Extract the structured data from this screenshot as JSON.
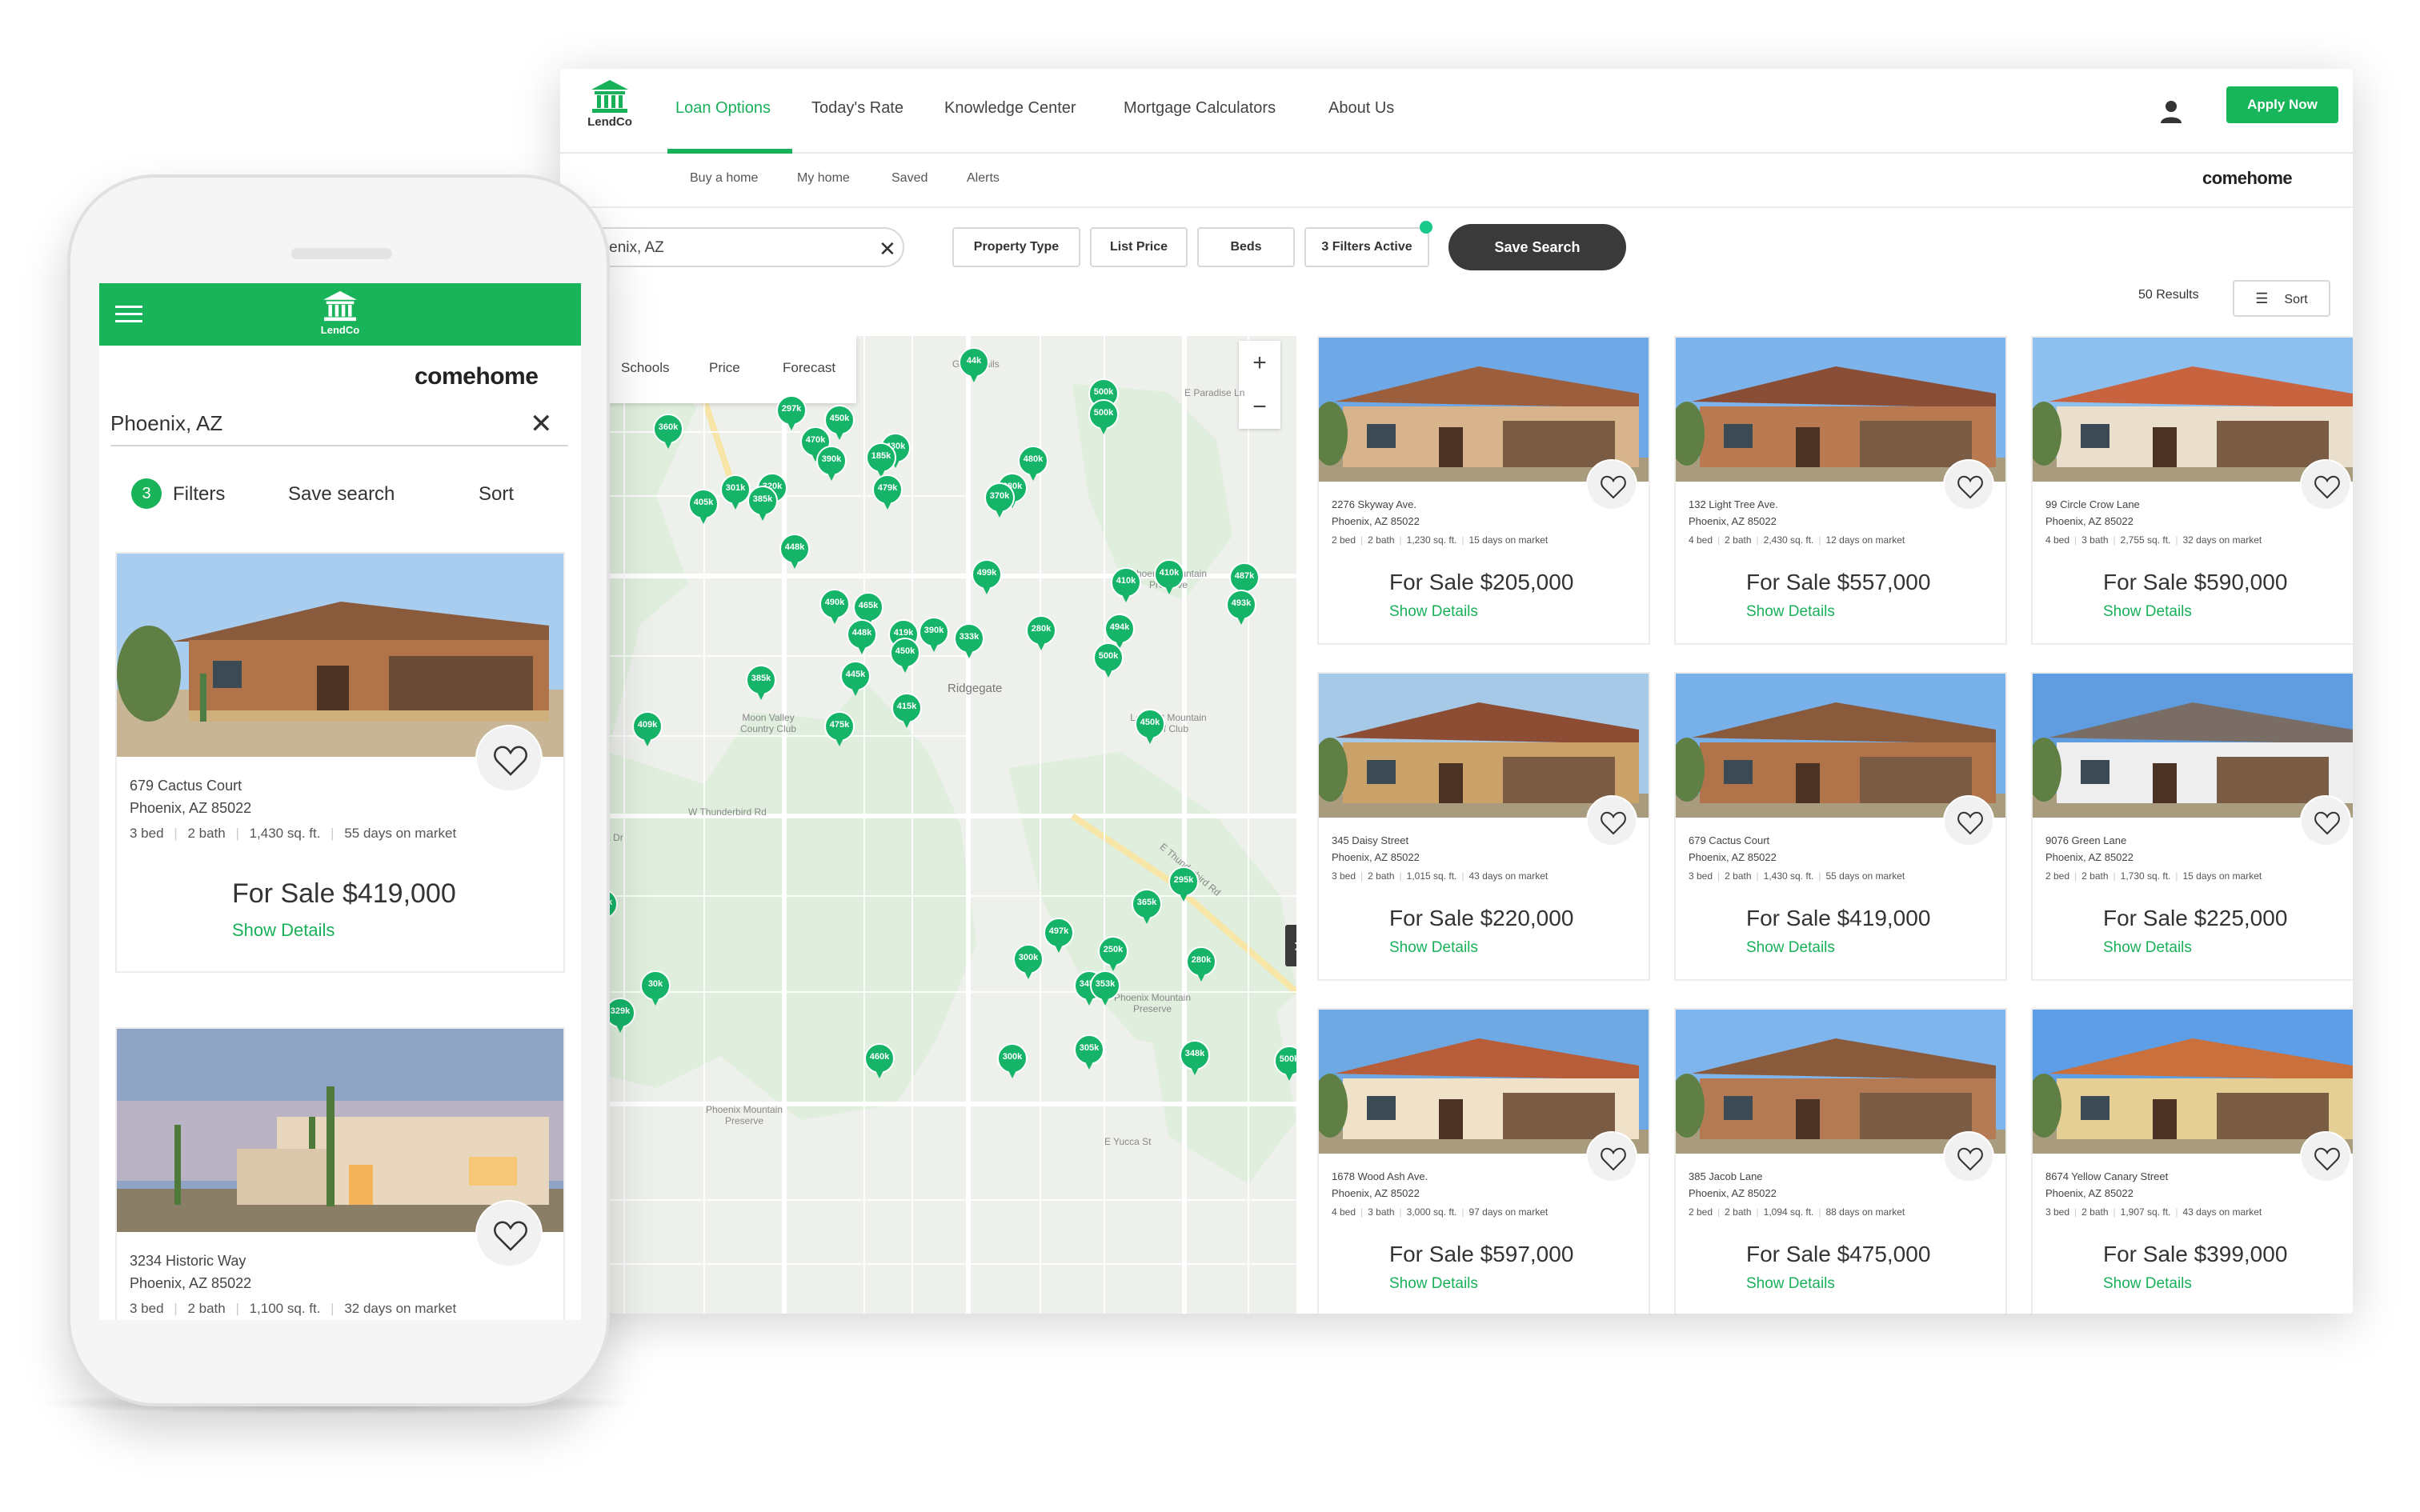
{
  "desktop": {
    "logo": {
      "name": "LendCo"
    },
    "nav": {
      "items": [
        "Loan Options",
        "Today's Rate",
        "Knowledge Center",
        "Mortgage Calculators",
        "About Us"
      ],
      "apply_label": "Apply Now"
    },
    "subnav": {
      "items": [
        "Buy a home",
        "My home",
        "Saved",
        "Alerts"
      ],
      "brand": "comehome"
    },
    "filters": {
      "search_value": "hoenix, AZ",
      "buttons": [
        "Property Type",
        "List Price",
        "Beds",
        "3 Filters Active"
      ],
      "save_search": "Save Search",
      "results": "50 Results",
      "sort": "Sort"
    },
    "map": {
      "tabs": [
        "me",
        "Schools",
        "Price",
        "Forecast"
      ],
      "labels": [
        "Ridgegate",
        "Phoenix Mountain Preserve",
        "Phoenix Mountain Preserve",
        "Phoenix Mountain Preserve",
        "Moon Valley Country Club",
        "Lookout Mountain Golf Club",
        "W Thunderbird Rd",
        "E Thunderbird Rd",
        "Greentrails",
        "E Paradise Ln",
        "W Andora Dr",
        "E Yucca St"
      ],
      "pins": [
        "44k",
        "297k",
        "450k",
        "500k",
        "500k",
        "360k",
        "470k",
        "430k",
        "185k",
        "390k",
        "480k",
        "301k",
        "320k",
        "380k",
        "405k",
        "385k",
        "479k",
        "370k",
        "448k",
        "499k",
        "375k",
        "410k",
        "410k",
        "487k",
        "493k",
        "490k",
        "465k",
        "448k",
        "419k",
        "390k",
        "333k",
        "280k",
        "494k",
        "450k",
        "500k",
        "385k",
        "445k",
        "415k",
        "409k",
        "475k",
        "450k",
        "239k",
        "295k",
        "365k",
        "497k",
        "250k",
        "300k",
        "30k",
        "345k",
        "353k",
        "280k",
        "170k",
        "329k",
        "460k",
        "300k",
        "305k",
        "348k",
        "500k"
      ]
    },
    "listings": [
      {
        "street": "2276 Skyway Ave.",
        "city": "Phoenix, AZ 85022",
        "beds": "2 bed",
        "baths": "2 bath",
        "sqft": "1,230 sq. ft.",
        "days": "15 days on market",
        "price": "For Sale $205,000",
        "details": "Show Details"
      },
      {
        "street": "132 Light Tree Ave.",
        "city": "Phoenix, AZ 85022",
        "beds": "4 bed",
        "baths": "2 bath",
        "sqft": "2,430 sq. ft.",
        "days": "12 days on market",
        "price": "For Sale $557,000",
        "details": "Show Details"
      },
      {
        "street": "99 Circle Crow Lane",
        "city": "Phoenix, AZ 85022",
        "beds": "4 bed",
        "baths": "3 bath",
        "sqft": "2,755 sq. ft.",
        "days": "32 days on market",
        "price": "For Sale $590,000",
        "details": "Show Details"
      },
      {
        "street": "345 Daisy Street",
        "city": "Phoenix, AZ 85022",
        "beds": "3 bed",
        "baths": "2 bath",
        "sqft": "1,015 sq. ft.",
        "days": "43 days on market",
        "price": "For Sale $220,000",
        "details": "Show Details"
      },
      {
        "street": "679 Cactus Court",
        "city": "Phoenix, AZ 85022",
        "beds": "3 bed",
        "baths": "2 bath",
        "sqft": "1,430 sq. ft.",
        "days": "55 days on market",
        "price": "For Sale $419,000",
        "details": "Show Details"
      },
      {
        "street": "9076 Green Lane",
        "city": "Phoenix, AZ 85022",
        "beds": "2 bed",
        "baths": "2 bath",
        "sqft": "1,730 sq. ft.",
        "days": "15 days on market",
        "price": "For Sale $225,000",
        "details": "Show Details"
      },
      {
        "street": "1678 Wood Ash Ave.",
        "city": "Phoenix, AZ 85022",
        "beds": "4 bed",
        "baths": "3 bath",
        "sqft": "3,000 sq. ft.",
        "days": "97 days on market",
        "price": "For Sale $597,000",
        "details": "Show Details"
      },
      {
        "street": "385 Jacob Lane",
        "city": "Phoenix, AZ 85022",
        "beds": "2 bed",
        "baths": "2 bath",
        "sqft": "1,094 sq. ft.",
        "days": "88 days on market",
        "price": "For Sale $475,000",
        "details": "Show Details"
      },
      {
        "street": "8674 Yellow Canary Street",
        "city": "Phoenix, AZ 85022",
        "beds": "3 bed",
        "baths": "2 bath",
        "sqft": "1,907 sq. ft.",
        "days": "43 days on market",
        "price": "For Sale $399,000",
        "details": "Show Details"
      }
    ]
  },
  "mobile": {
    "logo": "LendCo",
    "brand": "comehome",
    "search_value": "Phoenix, AZ",
    "filter_count": "3",
    "tools": [
      "Filters",
      "Save search",
      "Sort"
    ],
    "listings": [
      {
        "street": "679 Cactus Court",
        "city": "Phoenix, AZ 85022",
        "beds": "3 bed",
        "baths": "2 bath",
        "sqft": "1,430 sq. ft.",
        "days": "55 days on market",
        "price": "For Sale $419,000",
        "details": "Show Details"
      },
      {
        "street": "3234 Historic Way",
        "city": "Phoenix, AZ 85022",
        "beds": "3 bed",
        "baths": "2 bath",
        "sqft": "1,100 sq. ft.",
        "days": "32 days on market"
      }
    ]
  },
  "colors": {
    "brand_green": "#19b05a",
    "pin_green": "#15b469",
    "dark_button": "#3a3a3a"
  }
}
